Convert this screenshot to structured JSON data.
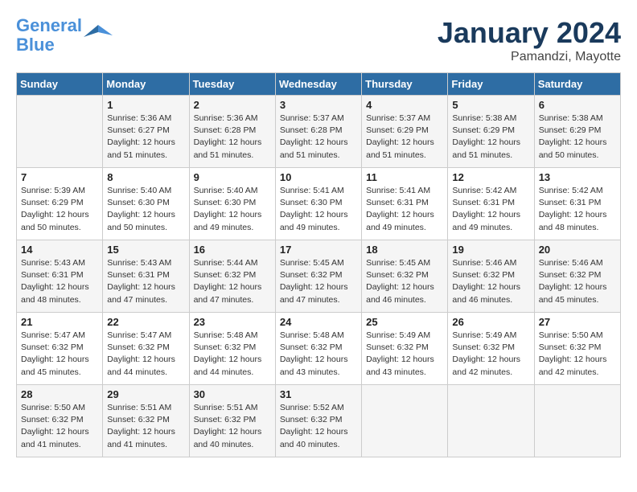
{
  "header": {
    "logo_line1": "General",
    "logo_line2": "Blue",
    "month": "January 2024",
    "location": "Pamandzi, Mayotte"
  },
  "weekdays": [
    "Sunday",
    "Monday",
    "Tuesday",
    "Wednesday",
    "Thursday",
    "Friday",
    "Saturday"
  ],
  "weeks": [
    [
      {
        "day": "",
        "info": ""
      },
      {
        "day": "1",
        "info": "Sunrise: 5:36 AM\nSunset: 6:27 PM\nDaylight: 12 hours\nand 51 minutes."
      },
      {
        "day": "2",
        "info": "Sunrise: 5:36 AM\nSunset: 6:28 PM\nDaylight: 12 hours\nand 51 minutes."
      },
      {
        "day": "3",
        "info": "Sunrise: 5:37 AM\nSunset: 6:28 PM\nDaylight: 12 hours\nand 51 minutes."
      },
      {
        "day": "4",
        "info": "Sunrise: 5:37 AM\nSunset: 6:29 PM\nDaylight: 12 hours\nand 51 minutes."
      },
      {
        "day": "5",
        "info": "Sunrise: 5:38 AM\nSunset: 6:29 PM\nDaylight: 12 hours\nand 51 minutes."
      },
      {
        "day": "6",
        "info": "Sunrise: 5:38 AM\nSunset: 6:29 PM\nDaylight: 12 hours\nand 50 minutes."
      }
    ],
    [
      {
        "day": "7",
        "info": "Sunrise: 5:39 AM\nSunset: 6:29 PM\nDaylight: 12 hours\nand 50 minutes."
      },
      {
        "day": "8",
        "info": "Sunrise: 5:40 AM\nSunset: 6:30 PM\nDaylight: 12 hours\nand 50 minutes."
      },
      {
        "day": "9",
        "info": "Sunrise: 5:40 AM\nSunset: 6:30 PM\nDaylight: 12 hours\nand 49 minutes."
      },
      {
        "day": "10",
        "info": "Sunrise: 5:41 AM\nSunset: 6:30 PM\nDaylight: 12 hours\nand 49 minutes."
      },
      {
        "day": "11",
        "info": "Sunrise: 5:41 AM\nSunset: 6:31 PM\nDaylight: 12 hours\nand 49 minutes."
      },
      {
        "day": "12",
        "info": "Sunrise: 5:42 AM\nSunset: 6:31 PM\nDaylight: 12 hours\nand 49 minutes."
      },
      {
        "day": "13",
        "info": "Sunrise: 5:42 AM\nSunset: 6:31 PM\nDaylight: 12 hours\nand 48 minutes."
      }
    ],
    [
      {
        "day": "14",
        "info": "Sunrise: 5:43 AM\nSunset: 6:31 PM\nDaylight: 12 hours\nand 48 minutes."
      },
      {
        "day": "15",
        "info": "Sunrise: 5:43 AM\nSunset: 6:31 PM\nDaylight: 12 hours\nand 47 minutes."
      },
      {
        "day": "16",
        "info": "Sunrise: 5:44 AM\nSunset: 6:32 PM\nDaylight: 12 hours\nand 47 minutes."
      },
      {
        "day": "17",
        "info": "Sunrise: 5:45 AM\nSunset: 6:32 PM\nDaylight: 12 hours\nand 47 minutes."
      },
      {
        "day": "18",
        "info": "Sunrise: 5:45 AM\nSunset: 6:32 PM\nDaylight: 12 hours\nand 46 minutes."
      },
      {
        "day": "19",
        "info": "Sunrise: 5:46 AM\nSunset: 6:32 PM\nDaylight: 12 hours\nand 46 minutes."
      },
      {
        "day": "20",
        "info": "Sunrise: 5:46 AM\nSunset: 6:32 PM\nDaylight: 12 hours\nand 45 minutes."
      }
    ],
    [
      {
        "day": "21",
        "info": "Sunrise: 5:47 AM\nSunset: 6:32 PM\nDaylight: 12 hours\nand 45 minutes."
      },
      {
        "day": "22",
        "info": "Sunrise: 5:47 AM\nSunset: 6:32 PM\nDaylight: 12 hours\nand 44 minutes."
      },
      {
        "day": "23",
        "info": "Sunrise: 5:48 AM\nSunset: 6:32 PM\nDaylight: 12 hours\nand 44 minutes."
      },
      {
        "day": "24",
        "info": "Sunrise: 5:48 AM\nSunset: 6:32 PM\nDaylight: 12 hours\nand 43 minutes."
      },
      {
        "day": "25",
        "info": "Sunrise: 5:49 AM\nSunset: 6:32 PM\nDaylight: 12 hours\nand 43 minutes."
      },
      {
        "day": "26",
        "info": "Sunrise: 5:49 AM\nSunset: 6:32 PM\nDaylight: 12 hours\nand 42 minutes."
      },
      {
        "day": "27",
        "info": "Sunrise: 5:50 AM\nSunset: 6:32 PM\nDaylight: 12 hours\nand 42 minutes."
      }
    ],
    [
      {
        "day": "28",
        "info": "Sunrise: 5:50 AM\nSunset: 6:32 PM\nDaylight: 12 hours\nand 41 minutes."
      },
      {
        "day": "29",
        "info": "Sunrise: 5:51 AM\nSunset: 6:32 PM\nDaylight: 12 hours\nand 41 minutes."
      },
      {
        "day": "30",
        "info": "Sunrise: 5:51 AM\nSunset: 6:32 PM\nDaylight: 12 hours\nand 40 minutes."
      },
      {
        "day": "31",
        "info": "Sunrise: 5:52 AM\nSunset: 6:32 PM\nDaylight: 12 hours\nand 40 minutes."
      },
      {
        "day": "",
        "info": ""
      },
      {
        "day": "",
        "info": ""
      },
      {
        "day": "",
        "info": ""
      }
    ]
  ]
}
